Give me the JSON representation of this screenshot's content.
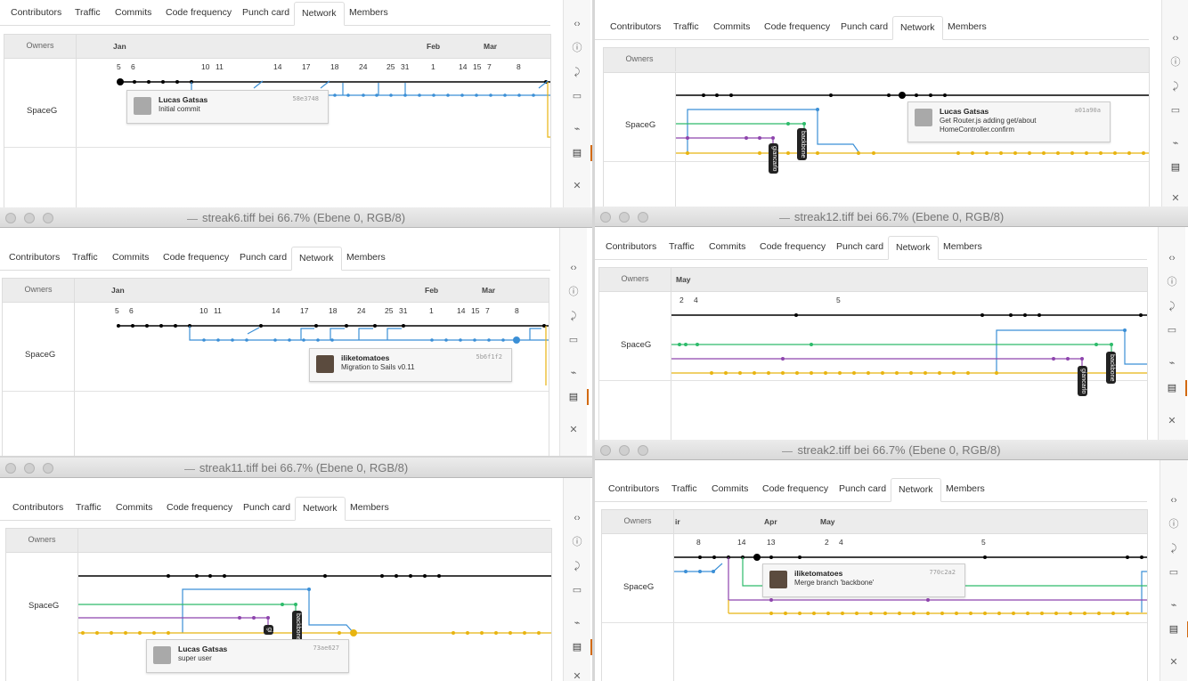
{
  "tabs": [
    "Contributors",
    "Traffic",
    "Commits",
    "Code frequency",
    "Punch card",
    "Network",
    "Members"
  ],
  "active_tab": "Network",
  "owners_header": "Owners",
  "owner": "SpaceG",
  "sidebar_icons": [
    "code-icon",
    "issues-icon",
    "pull-requests-icon",
    "wiki-icon",
    "pulse-icon",
    "graphs-icon",
    "settings-icon"
  ],
  "sidebar_glyphs": [
    "‹›",
    "ⓘ",
    "⤸",
    "▭",
    "⌁",
    "▤",
    "✕"
  ],
  "windows": {
    "w1": {
      "months": [
        "Jan",
        "Feb",
        "Mar"
      ],
      "days": [
        "5",
        "6",
        "10",
        "11",
        "14",
        "17",
        "18",
        "24",
        "25",
        "31",
        "1",
        "14",
        "15",
        "7",
        "8"
      ],
      "tooltip": {
        "author": "Lucas Gatsas",
        "message": "Initial commit",
        "sha": "58e3748"
      }
    },
    "w2": {
      "tooltip": {
        "author": "Lucas Gatsas",
        "message": "Get Router.js adding get/about HomeController.confirm",
        "sha": "a01a90a"
      },
      "branches": [
        "giancarlo",
        "backbone"
      ]
    },
    "w3": {
      "title": "streak6.tiff bei 66.7% (Ebene 0, RGB/8)",
      "months": [
        "Jan",
        "Feb",
        "Mar"
      ],
      "days": [
        "5",
        "6",
        "10",
        "11",
        "14",
        "17",
        "18",
        "24",
        "25",
        "31",
        "1",
        "14",
        "15",
        "7",
        "8"
      ],
      "tooltip": {
        "author": "iliketomatoes",
        "message": "Migration to Sails v0.11",
        "sha": "5b6f1f2"
      }
    },
    "w4": {
      "title": "streak12.tiff bei 66.7% (Ebene 0, RGB/8)",
      "months": [
        "May"
      ],
      "days": [
        "2",
        "4",
        "5"
      ],
      "branches": [
        "giancarlo",
        "backbone"
      ]
    },
    "w5": {
      "title": "streak11.tiff bei 66.7% (Ebene 0, RGB/8)",
      "tooltip": {
        "author": "Lucas Gatsas",
        "message": "super user",
        "sha": "73ae627"
      },
      "branches": [
        "gi",
        "backbone"
      ]
    },
    "w6": {
      "title": "streak2.tiff bei 66.7% (Ebene 0, RGB/8)",
      "months": [
        "ir",
        "Apr",
        "May"
      ],
      "days": [
        "8",
        "14",
        "13",
        "2",
        "4",
        "5"
      ],
      "tooltip": {
        "author": "iliketomatoes",
        "message": "Merge branch 'backbone'",
        "sha": "770c2a2"
      }
    }
  }
}
